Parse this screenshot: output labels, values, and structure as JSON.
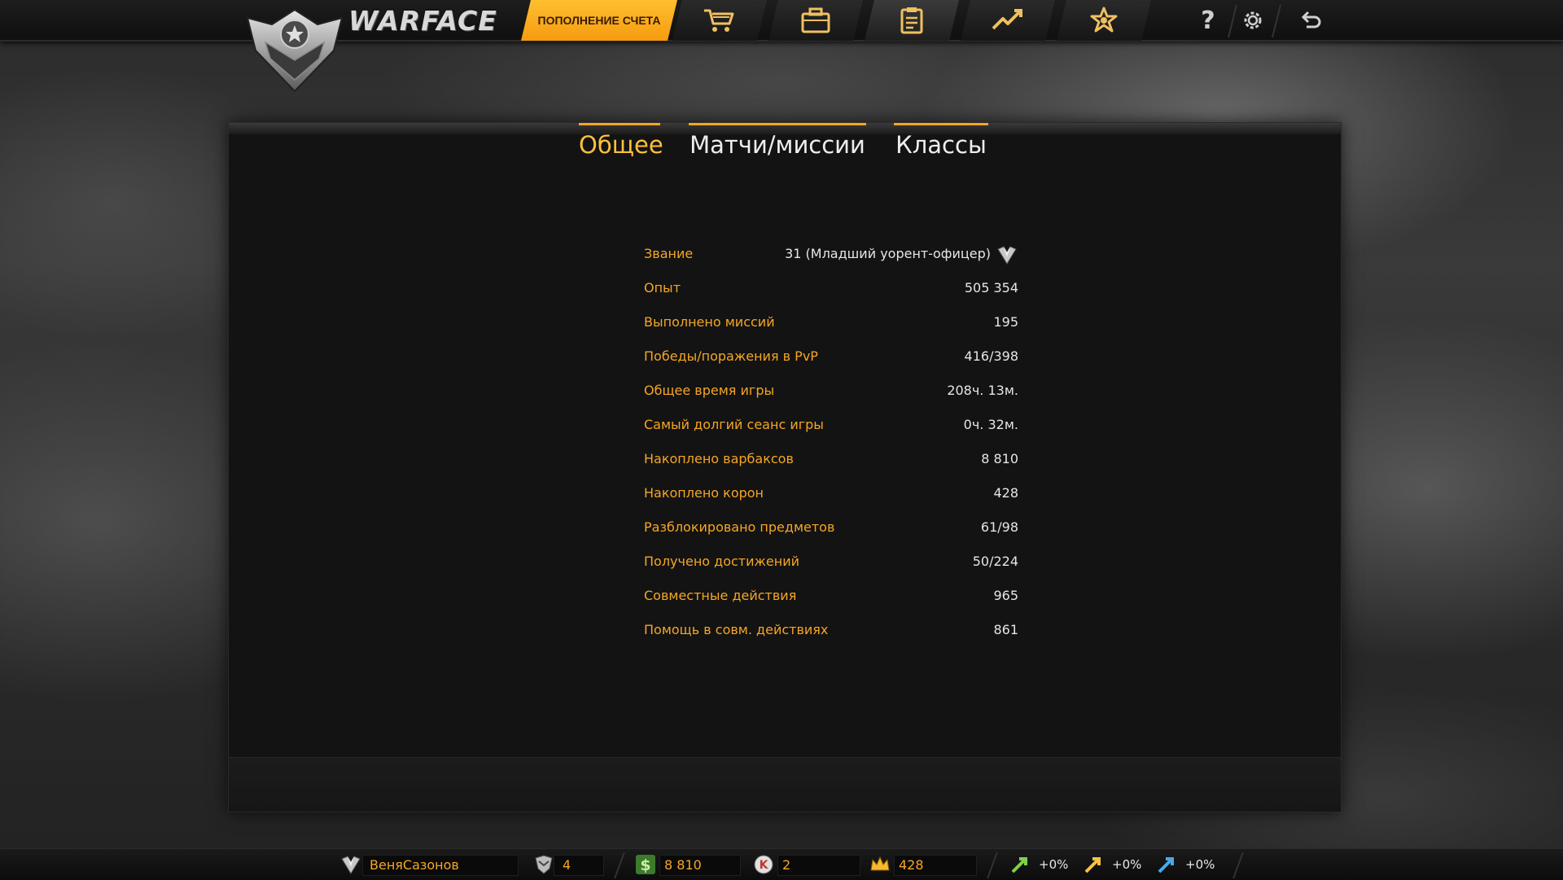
{
  "header": {
    "logo_text": "WARFACE",
    "topup_label": "ПОПОЛНЕНИЕ СЧЕТА",
    "nav_icons": [
      "cart-icon",
      "case-icon",
      "clipboard-icon",
      "chart-icon",
      "achievement-icon"
    ],
    "active_nav": "clipboard-icon",
    "utility_icons": [
      "help-icon",
      "settings-icon",
      "back-icon"
    ],
    "help_glyph": "?",
    "colors": {
      "accent": "#f5a623",
      "topup_bg": "#ffae1f"
    }
  },
  "tabs": [
    {
      "label": "Общее",
      "active": true
    },
    {
      "label": "Матчи/миссии",
      "active": false
    },
    {
      "label": "Классы",
      "active": false
    }
  ],
  "stats": {
    "rank": {
      "label": "Звание",
      "value": "31 (Младший уорент-офицер)"
    },
    "rows": [
      {
        "label": "Опыт",
        "value": "505 354"
      },
      {
        "label": "Выполнено миссий",
        "value": "195"
      },
      {
        "label": "Победы/поражения в PvP",
        "value": "416/398"
      },
      {
        "label": "Общее время игры",
        "value": "208ч. 13м."
      },
      {
        "label": "Самый долгий сеанс игры",
        "value": "0ч. 32м."
      },
      {
        "label": "Накоплено варбаксов",
        "value": "8 810"
      },
      {
        "label": "Накоплено корон",
        "value": "428"
      },
      {
        "label": "Разблокировано предметов",
        "value": "61/98"
      },
      {
        "label": "Получено достижений",
        "value": "50/224"
      },
      {
        "label": "Совместные действия",
        "value": "965"
      },
      {
        "label": "Помощь в совм. действиях",
        "value": "861"
      }
    ]
  },
  "footer_bar": {
    "player_name": "ВеняСазонов",
    "rank_level": "4",
    "warbucks": "8 810",
    "credits": "2",
    "crowns": "428",
    "boosts": [
      {
        "icon": "xp-boost-icon",
        "value": "+0%",
        "color": "#7fd04b"
      },
      {
        "icon": "money-boost-icon",
        "value": "+0%",
        "color": "#f5c242"
      },
      {
        "icon": "vp-boost-icon",
        "value": "+0%",
        "color": "#4aa8e8"
      }
    ]
  }
}
